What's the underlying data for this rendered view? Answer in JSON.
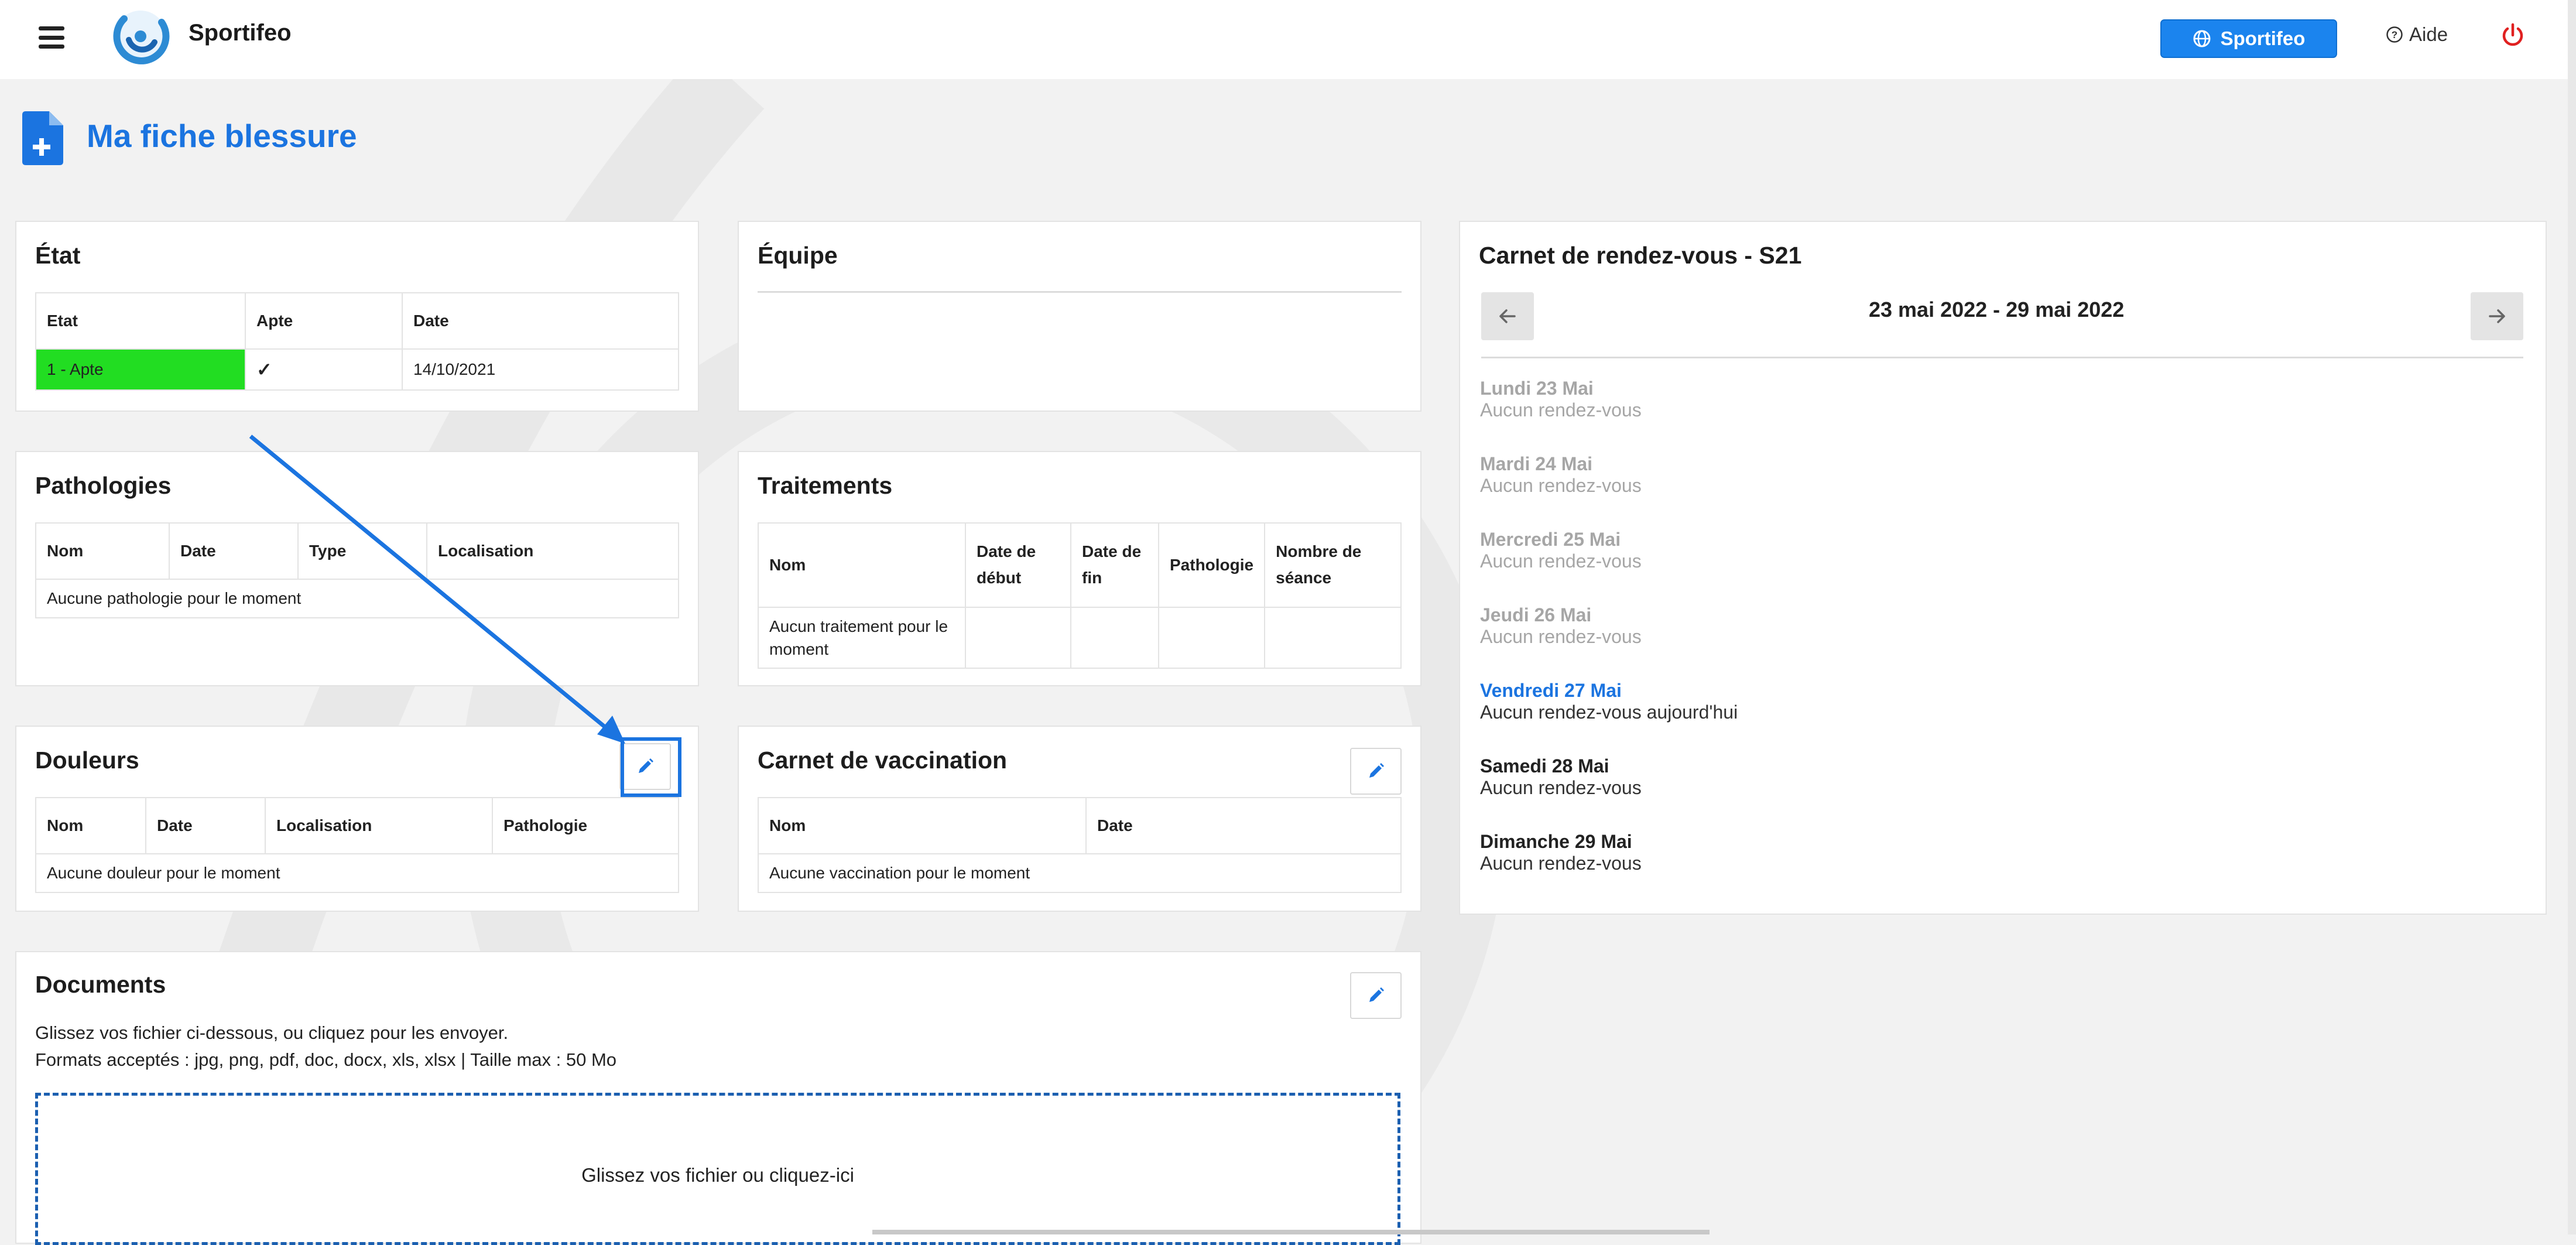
{
  "app": {
    "brand": "Sportifeo"
  },
  "header": {
    "sportifeo_button": "Sportifeo",
    "help": "Aide"
  },
  "page": {
    "title": "Ma fiche blessure"
  },
  "etat": {
    "title": "État",
    "columns": [
      "Etat",
      "Apte",
      "Date"
    ],
    "row": {
      "etat": "1 - Apte",
      "apte": "✓",
      "date": "14/10/2021"
    },
    "status_color": "#22dd22"
  },
  "equipe": {
    "title": "Équipe"
  },
  "pathologies": {
    "title": "Pathologies",
    "columns": [
      "Nom",
      "Date",
      "Type",
      "Localisation"
    ],
    "empty": "Aucune pathologie pour le moment"
  },
  "traitements": {
    "title": "Traitements",
    "columns": [
      "Nom",
      "Date de début",
      "Date de fin",
      "Pathologie",
      "Nombre de séance"
    ],
    "empty": "Aucun traitement pour le moment"
  },
  "douleurs": {
    "title": "Douleurs",
    "columns": [
      "Nom",
      "Date",
      "Localisation",
      "Pathologie"
    ],
    "empty": "Aucune douleur pour le moment"
  },
  "vaccination": {
    "title": "Carnet de vaccination",
    "columns": [
      "Nom",
      "Date"
    ],
    "empty": "Aucune vaccination pour le moment"
  },
  "documents": {
    "title": "Documents",
    "line1": "Glissez vos fichier ci-dessous, ou cliquez pour les envoyer.",
    "line2": "Formats acceptés : jpg, png, pdf, doc, docx, xls, xlsx | Taille max : 50 Mo",
    "dropzone": "Glissez vos fichier ou cliquez-ici"
  },
  "calendar": {
    "title": "Carnet de rendez-vous - S21",
    "range": "23 mai 2022 - 29 mai 2022",
    "days": [
      {
        "name": "Lundi 23 Mai",
        "text": "Aucun rendez-vous",
        "state": "past"
      },
      {
        "name": "Mardi 24 Mai",
        "text": "Aucun rendez-vous",
        "state": "past"
      },
      {
        "name": "Mercredi 25 Mai",
        "text": "Aucun rendez-vous",
        "state": "past"
      },
      {
        "name": "Jeudi 26 Mai",
        "text": "Aucun rendez-vous",
        "state": "past"
      },
      {
        "name": "Vendredi 27 Mai",
        "text": "Aucun rendez-vous aujourd'hui",
        "state": "today"
      },
      {
        "name": "Samedi 28 Mai",
        "text": "Aucun rendez-vous",
        "state": "future"
      },
      {
        "name": "Dimanche 29 Mai",
        "text": "Aucun rendez-vous",
        "state": "future"
      }
    ]
  },
  "colors": {
    "accent": "#1b74e0",
    "button": "#1b84ee",
    "power": "#e02020",
    "past_day": "#a6a6a6"
  },
  "icons": [
    "menu-icon",
    "sportifeo-logo",
    "globe-icon",
    "help-circle-icon",
    "power-icon",
    "file-plus-icon",
    "check-icon",
    "pencil-icon",
    "arrow-left-icon",
    "arrow-right-icon"
  ]
}
